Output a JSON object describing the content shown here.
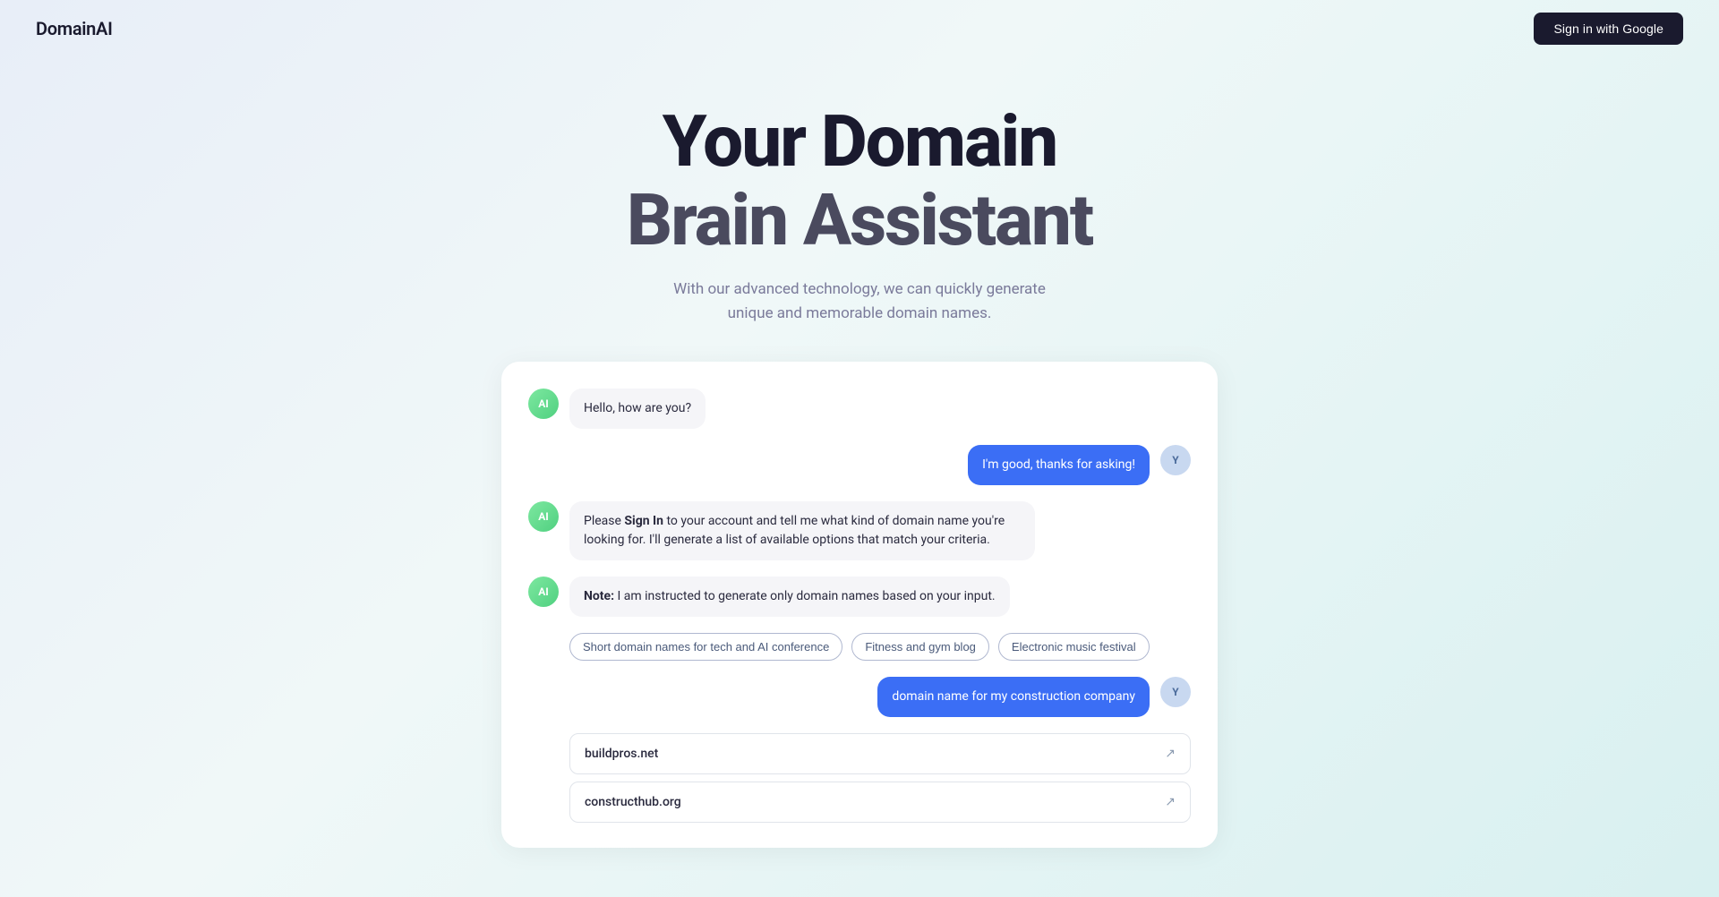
{
  "header": {
    "logo": "DomainAI",
    "sign_in_label": "Sign in with Google"
  },
  "hero": {
    "title_line1": "Your Domain",
    "title_line2": "Brain Assistant",
    "subtitle": "With our advanced technology, we can quickly generate unique and memorable domain names."
  },
  "chat": {
    "messages": [
      {
        "id": "msg1",
        "sender": "ai",
        "avatar_label": "AI",
        "text": "Hello, how are you?"
      },
      {
        "id": "msg2",
        "sender": "user",
        "avatar_label": "Y",
        "text": "I'm good, thanks for asking!"
      },
      {
        "id": "msg3",
        "sender": "ai",
        "avatar_label": "AI",
        "text_parts": [
          {
            "type": "normal",
            "content": "Please "
          },
          {
            "type": "bold",
            "content": "Sign In"
          },
          {
            "type": "normal",
            "content": " to your account and tell me what kind of domain name you're looking for. I'll generate a list of available options that match your criteria."
          }
        ]
      },
      {
        "id": "msg4",
        "sender": "ai",
        "avatar_label": "AI",
        "text_parts": [
          {
            "type": "bold",
            "content": "Note:"
          },
          {
            "type": "normal",
            "content": " I am instructed to generate only domain names based on your input."
          }
        ]
      }
    ],
    "suggestions": [
      "Short domain names for tech and AI conference",
      "Fitness and gym blog",
      "Electronic music festival"
    ],
    "user_message": {
      "sender": "user",
      "avatar_label": "Y",
      "text": "domain name for my construction company"
    },
    "domain_results": [
      {
        "name": "buildpros.net"
      },
      {
        "name": "constructhub.org"
      }
    ]
  }
}
